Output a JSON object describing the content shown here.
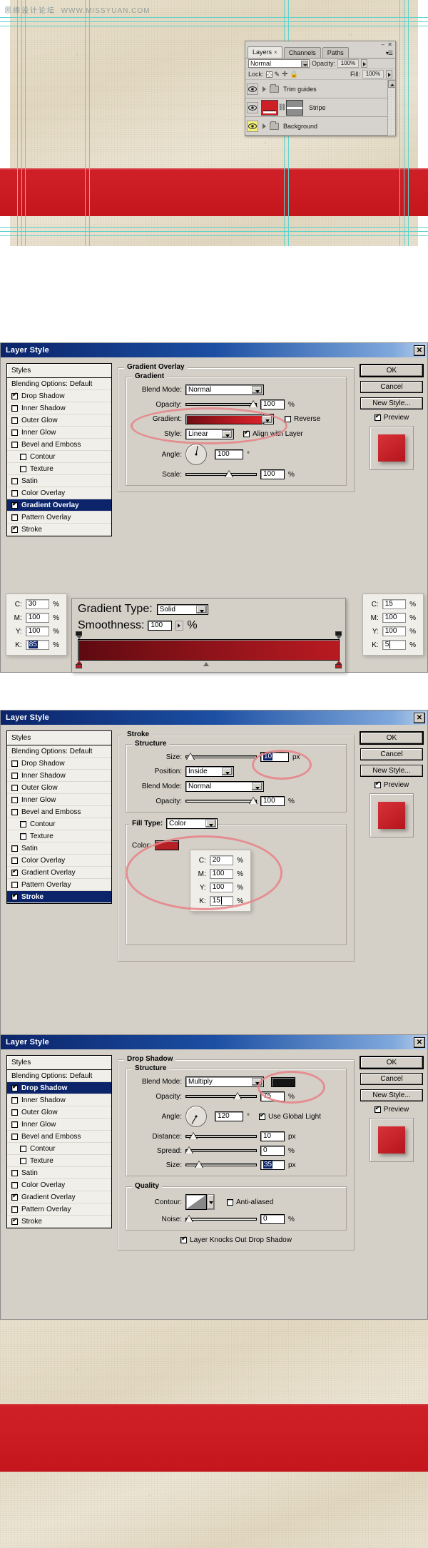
{
  "watermark": {
    "cn": "思缘设计论坛",
    "url": "WWW.MISSYUAN.COM"
  },
  "layers_panel": {
    "tabs": [
      {
        "label": "Layers",
        "close": "×",
        "active": true
      },
      {
        "label": "Channels",
        "active": false
      },
      {
        "label": "Paths",
        "active": false
      }
    ],
    "blend_mode": "Normal",
    "opacity_label": "Opacity:",
    "opacity_value": "100%",
    "lock_label": "Lock:",
    "fill_label": "Fill:",
    "fill_value": "100%",
    "rows": [
      {
        "name": "Trim guides",
        "type": "group",
        "visible": true,
        "highlighted": false
      },
      {
        "name": "Stripe",
        "type": "layer",
        "visible": true,
        "highlighted": false
      },
      {
        "name": "Background",
        "type": "group",
        "visible": true,
        "highlighted": true
      }
    ]
  },
  "style_items": [
    "Blending Options: Default",
    "Drop Shadow",
    "Inner Shadow",
    "Outer Glow",
    "Inner Glow",
    "Bevel and Emboss",
    "Contour",
    "Texture",
    "Satin",
    "Color Overlay",
    "Gradient Overlay",
    "Pattern Overlay",
    "Stroke"
  ],
  "buttons": {
    "ok": "OK",
    "cancel": "Cancel",
    "new_style": "New Style...",
    "preview": "Preview"
  },
  "dialog_title": "Layer Style",
  "close_glyph": "✕",
  "dialog_gradient": {
    "title": "Layer Style",
    "styles_header": "Styles",
    "selected_style": "Gradient Overlay",
    "checked_styles": [
      "Drop Shadow",
      "Gradient Overlay",
      "Stroke"
    ],
    "section": "Gradient Overlay",
    "subsection": "Gradient",
    "fields": {
      "blend_mode_label": "Blend Mode:",
      "blend_mode_value": "Normal",
      "opacity_label": "Opacity:",
      "opacity_value": "100",
      "opacity_unit": "%",
      "gradient_label": "Gradient:",
      "reverse_label": "Reverse",
      "style_label": "Style:",
      "style_value": "Linear",
      "align_label": "Align with Layer",
      "angle_label": "Angle:",
      "angle_value": "100",
      "angle_unit": "°",
      "scale_label": "Scale:",
      "scale_value": "100",
      "scale_unit": "%"
    },
    "gradient_editor": {
      "type_label": "Gradient Type:",
      "type_value": "Solid",
      "smoothness_label": "Smoothness:",
      "smoothness_value": "100",
      "smoothness_unit": "%"
    },
    "cmyk_left": {
      "c": "30",
      "m": "100",
      "y": "100",
      "k": "85",
      "unit": "%",
      "highlight": "k"
    },
    "cmyk_right": {
      "c": "15",
      "m": "100",
      "y": "100",
      "k": "5",
      "unit": "%",
      "highlight": "none"
    }
  },
  "dialog_stroke": {
    "title": "Layer Style",
    "styles_header": "Styles",
    "selected_style": "Stroke",
    "checked_styles": [
      "Gradient Overlay",
      "Stroke"
    ],
    "section": "Stroke",
    "subsection": "Structure",
    "fields": {
      "size_label": "Size:",
      "size_value": "10",
      "size_unit": "px",
      "position_label": "Position:",
      "position_value": "Inside",
      "blend_mode_label": "Blend Mode:",
      "blend_mode_value": "Normal",
      "opacity_label": "Opacity:",
      "opacity_value": "100",
      "opacity_unit": "%",
      "fill_type_label": "Fill Type:",
      "fill_type_value": "Color",
      "color_label": "Color:"
    },
    "cmyk": {
      "c": "20",
      "m": "100",
      "y": "100",
      "k": "15",
      "unit": "%"
    }
  },
  "dialog_shadow": {
    "title": "Layer Style",
    "styles_header": "Styles",
    "selected_style": "Drop Shadow",
    "checked_styles": [
      "Drop Shadow",
      "Gradient Overlay",
      "Stroke"
    ],
    "section": "Drop Shadow",
    "subsection": "Structure",
    "quality_label": "Quality",
    "fields": {
      "blend_mode_label": "Blend Mode:",
      "blend_mode_value": "Multiply",
      "opacity_label": "Opacity:",
      "opacity_value": "75",
      "opacity_unit": "%",
      "angle_label": "Angle:",
      "angle_value": "120",
      "angle_unit": "°",
      "global_light_label": "Use Global Light",
      "distance_label": "Distance:",
      "distance_value": "10",
      "distance_unit": "px",
      "spread_label": "Spread:",
      "spread_value": "0",
      "spread_unit": "%",
      "size_label": "Size:",
      "size_value": "35",
      "size_unit": "px",
      "contour_label": "Contour:",
      "antialiased_label": "Anti-aliased",
      "noise_label": "Noise:",
      "noise_value": "0",
      "noise_unit": "%",
      "knockout_label": "Layer Knocks Out Drop Shadow"
    }
  },
  "colors": {
    "stripe_red": "#cc1c24",
    "paper": "#e7dfc9",
    "guide_cyan": "#5fd3cd",
    "titlebar_blue": "#0b246a",
    "annotation_pink": "#e88287",
    "shadow_black": "#151515"
  }
}
